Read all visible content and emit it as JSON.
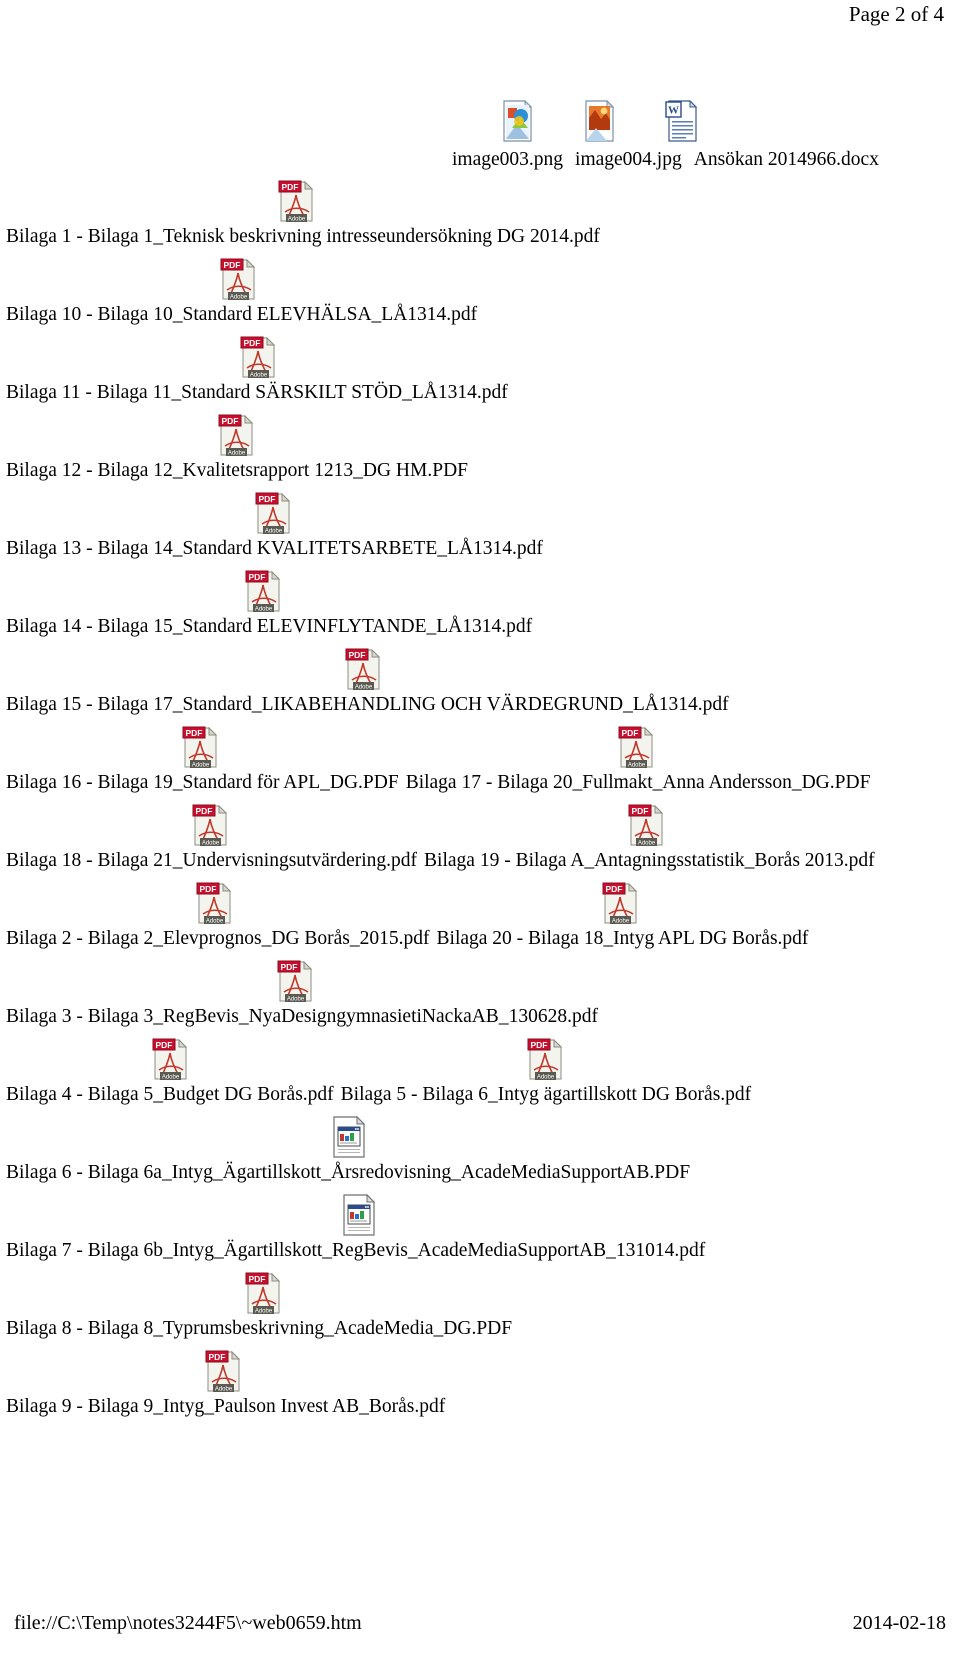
{
  "header": {
    "page_label": "Page 2 of 4"
  },
  "top_attachments": [
    {
      "label": "image003.png",
      "icon": "png-image-file-icon"
    },
    {
      "label": "image004.jpg",
      "icon": "jpg-image-file-icon"
    },
    {
      "label": "Ansökan 2014966.docx",
      "icon": "word-document-file-icon"
    }
  ],
  "attachment_rows": [
    {
      "icon_offsets": [
        278
      ],
      "items": [
        {
          "label": "Bilaga 1 - Bilaga 1_Teknisk beskrivning intresseundersökning DG 2014.pdf",
          "icon": "pdf-file-icon"
        }
      ]
    },
    {
      "icon_offsets": [
        220
      ],
      "items": [
        {
          "label": "Bilaga 10 - Bilaga 10_Standard ELEVHÄLSA_LÅ1314.pdf",
          "icon": "pdf-file-icon"
        }
      ]
    },
    {
      "icon_offsets": [
        240
      ],
      "items": [
        {
          "label": "Bilaga 11 - Bilaga 11_Standard SÄRSKILT STÖD_LÅ1314.pdf",
          "icon": "pdf-file-icon"
        }
      ]
    },
    {
      "icon_offsets": [
        218
      ],
      "items": [
        {
          "label": "Bilaga 12 - Bilaga 12_Kvalitetsrapport 1213_DG HM.PDF",
          "icon": "pdf-file-icon"
        }
      ]
    },
    {
      "icon_offsets": [
        255
      ],
      "items": [
        {
          "label": "Bilaga 13 - Bilaga 14_Standard KVALITETSARBETE_LÅ1314.pdf",
          "icon": "pdf-file-icon"
        }
      ]
    },
    {
      "icon_offsets": [
        245
      ],
      "items": [
        {
          "label": "Bilaga 14 - Bilaga 15_Standard ELEVINFLYTANDE_LÅ1314.pdf",
          "icon": "pdf-file-icon"
        }
      ]
    },
    {
      "icon_offsets": [
        345
      ],
      "items": [
        {
          "label": "Bilaga 15 - Bilaga 17_Standard_LIKABEHANDLING OCH VÄRDEGRUND_LÅ1314.pdf",
          "icon": "pdf-file-icon"
        }
      ]
    },
    {
      "icon_offsets": [
        182,
        618
      ],
      "items": [
        {
          "label": "Bilaga 16 - Bilaga 19_Standard för APL_DG.PDF",
          "icon": "pdf-file-icon"
        },
        {
          "label": "Bilaga 17 - Bilaga 20_Fullmakt_Anna Andersson_DG.PDF",
          "icon": "pdf-file-icon"
        }
      ]
    },
    {
      "icon_offsets": [
        192,
        628
      ],
      "items": [
        {
          "label": "Bilaga 18 - Bilaga 21_Undervisningsutvärdering.pdf",
          "icon": "pdf-file-icon"
        },
        {
          "label": "Bilaga 19 - Bilaga A_Antagningsstatistik_Borås 2013.pdf",
          "icon": "pdf-file-icon"
        }
      ]
    },
    {
      "icon_offsets": [
        196,
        602
      ],
      "items": [
        {
          "label": "Bilaga 2 - Bilaga 2_Elevprognos_DG Borås_2015.pdf",
          "icon": "pdf-file-icon"
        },
        {
          "label": "Bilaga 20 - Bilaga 18_Intyg APL DG Borås.pdf",
          "icon": "pdf-file-icon"
        }
      ]
    },
    {
      "icon_offsets": [
        277
      ],
      "items": [
        {
          "label": "Bilaga 3 - Bilaga 3_RegBevis_NyaDesigngymnasietiNackaAB_130628.pdf",
          "icon": "pdf-file-icon"
        }
      ]
    },
    {
      "icon_offsets": [
        152,
        527
      ],
      "items": [
        {
          "label": "Bilaga 4 - Bilaga 5_Budget DG Borås.pdf",
          "icon": "pdf-file-icon"
        },
        {
          "label": "Bilaga 5 - Bilaga 6_Intyg ägartillskott DG Borås.pdf",
          "icon": "pdf-file-icon"
        }
      ]
    },
    {
      "icon_offsets": [
        330
      ],
      "items": [
        {
          "label": "Bilaga 6 - Bilaga 6a_Intyg_Ägartillskott_Årsredovisning_AcadeMediaSupportAB.PDF",
          "icon": "html-document-file-icon"
        }
      ]
    },
    {
      "icon_offsets": [
        340
      ],
      "items": [
        {
          "label": "Bilaga 7 - Bilaga 6b_Intyg_Ägartillskott_RegBevis_AcadeMediaSupportAB_131014.pdf",
          "icon": "html-document-file-icon"
        }
      ]
    },
    {
      "icon_offsets": [
        245
      ],
      "items": [
        {
          "label": "Bilaga 8 - Bilaga 8_Typrumsbeskrivning_AcadeMedia_DG.PDF",
          "icon": "pdf-file-icon"
        }
      ]
    },
    {
      "icon_offsets": [
        205
      ],
      "items": [
        {
          "label": "Bilaga 9 - Bilaga 9_Intyg_Paulson Invest AB_Borås.pdf",
          "icon": "pdf-file-icon"
        }
      ]
    }
  ],
  "footer": {
    "file_path": "file://C:\\Temp\\notes3244F5\\~web0659.htm",
    "date": "2014-02-18"
  },
  "colors": {
    "pdf_red": "#c8102e",
    "text": "#000000",
    "page_background": "#ffffff",
    "icon_page": "#f2f2ee",
    "icon_border": "#9a9a8e"
  }
}
